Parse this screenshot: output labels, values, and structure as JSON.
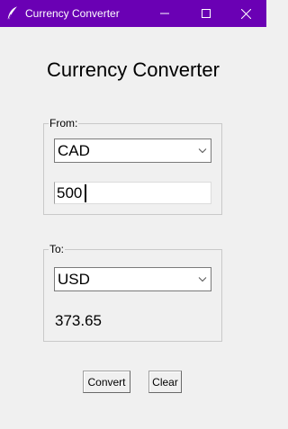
{
  "window": {
    "title": "Currency Converter",
    "titlebar_color": "#6a00b4"
  },
  "heading": "Currency Converter",
  "from": {
    "legend": "From:",
    "currency": "CAD",
    "amount": "500"
  },
  "to": {
    "legend": "To:",
    "currency": "USD",
    "result": "373.65"
  },
  "buttons": {
    "convert": "Convert",
    "clear": "Clear"
  },
  "icons": {
    "app": "feather-icon",
    "minimize": "minimize-icon",
    "maximize": "maximize-icon",
    "close": "close-icon",
    "dropdown": "chevron-down-icon"
  }
}
